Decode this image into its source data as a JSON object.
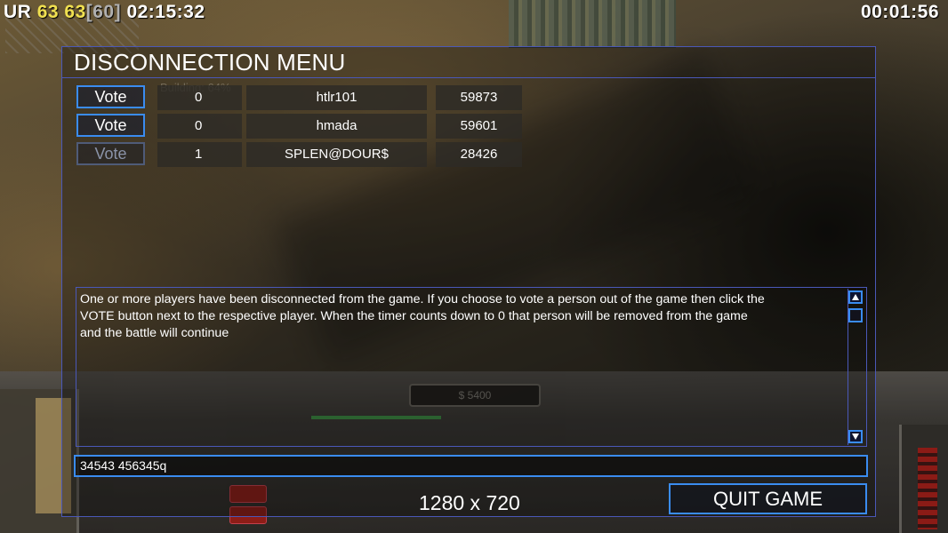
{
  "hud": {
    "left": {
      "prefix": "UR",
      "fps_a": "63",
      "fps_b": "63",
      "fps_bracket": "[60]",
      "game_time": "02:15:32"
    },
    "right_timer": "00:01:56",
    "money": "$ 5400"
  },
  "menu": {
    "title": "DISCONNECTION MENU",
    "ghost_text": "Building: 64%",
    "players": [
      {
        "vote_label": "Vote",
        "votes": "0",
        "name": "htlr101",
        "ping": "59873",
        "enabled": true
      },
      {
        "vote_label": "Vote",
        "votes": "0",
        "name": "hmada",
        "ping": "59601",
        "enabled": true
      },
      {
        "vote_label": "Vote",
        "votes": "1",
        "name": "SPLEN@DOUR$",
        "ping": "28426",
        "enabled": false
      }
    ],
    "message": "One or more players have been disconnected from the game. If you choose to vote a person out of the game then click the\n VOTE button next to the respective player. When the timer counts down to 0 that person will be removed from the game\n and the battle will continue",
    "chat_input_value": "34543 456345q",
    "resolution": "1280 x 720",
    "quit_label": "QUIT GAME"
  },
  "colors": {
    "accent_border": "#3a8cf0",
    "panel_border": "#4a58b8",
    "fps_yellow": "#f0e050"
  }
}
